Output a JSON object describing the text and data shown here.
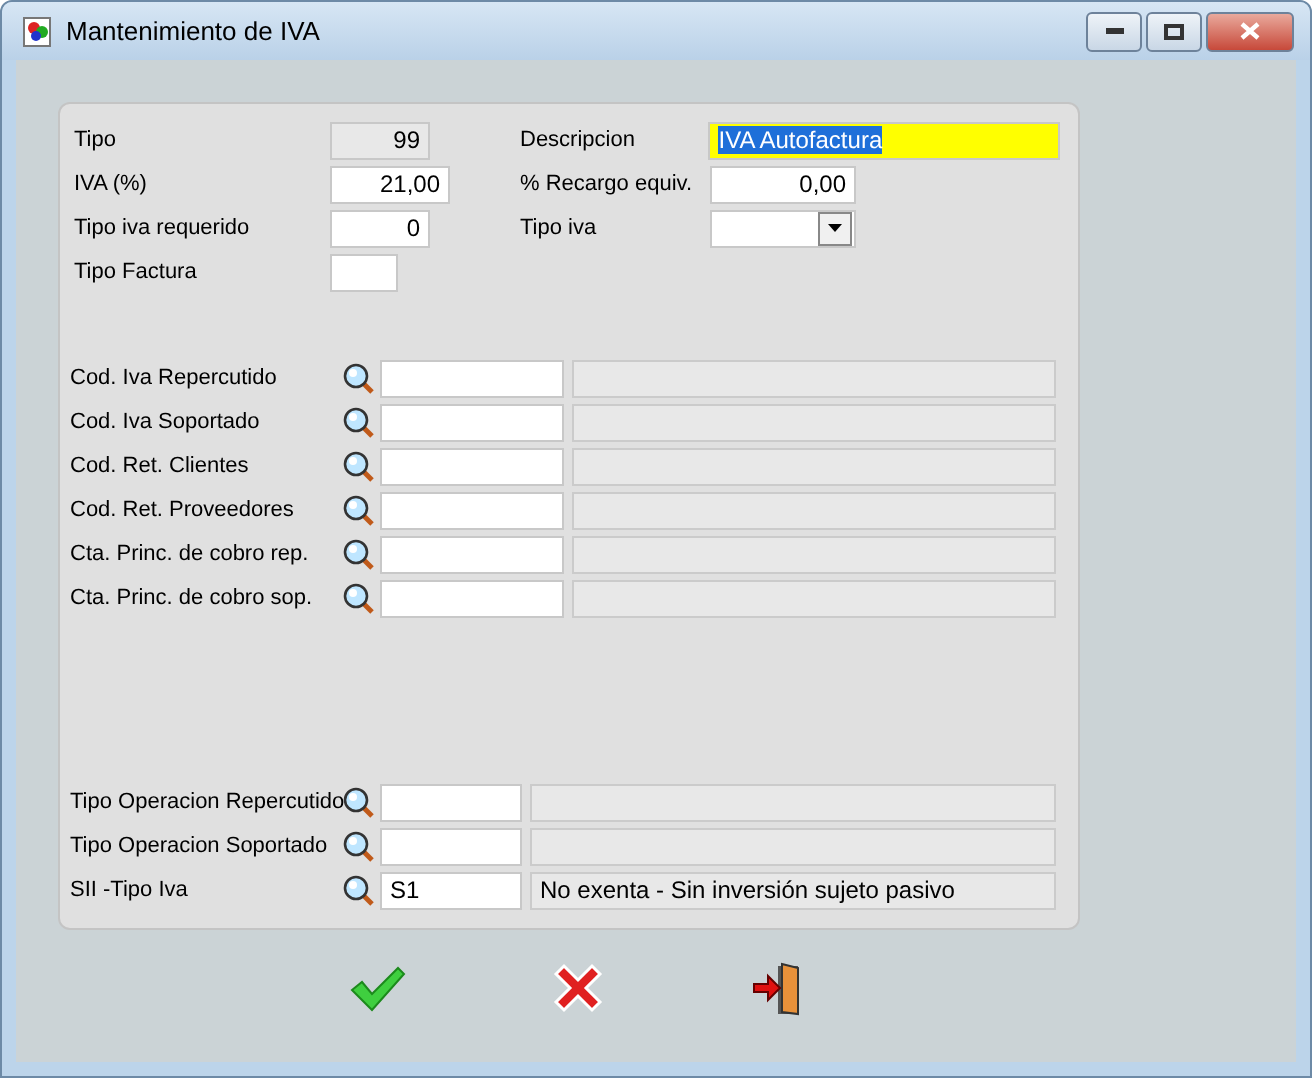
{
  "window": {
    "title": "Mantenimiento de IVA"
  },
  "top_rows": [
    {
      "left": {
        "label": "Tipo",
        "value": "99",
        "kind": "readonly"
      },
      "right": {
        "label": "Descripcion",
        "value": "IVA Autofactura",
        "kind": "highlight",
        "selected": true
      }
    },
    {
      "left": {
        "label": "IVA (%)",
        "value": "21,00",
        "kind": "text"
      },
      "right": {
        "label": "% Recargo equiv.",
        "value": "0,00",
        "kind": "text"
      }
    },
    {
      "left": {
        "label": "Tipo iva requerido",
        "value": "0",
        "kind": "text"
      },
      "right": {
        "label": "Tipo iva",
        "kind": "combo"
      }
    },
    {
      "left": {
        "label": "Tipo Factura",
        "kind": "text"
      }
    }
  ],
  "lookups": [
    {
      "label": "Cod. Iva Repercutido"
    },
    {
      "label": "Cod. Iva Soportado"
    },
    {
      "label": "Cod. Ret. Clientes"
    },
    {
      "label": "Cod. Ret. Proveedores"
    },
    {
      "label": "Cta. Princ. de cobro  rep."
    },
    {
      "label": "Cta. Princ. de cobro  sop."
    }
  ],
  "operations": [
    {
      "label": "Tipo Operacion Repercutido"
    },
    {
      "label": "Tipo Operacion Soportado"
    },
    {
      "label": "SII -Tipo Iva",
      "code": "S1",
      "description": "No exenta - Sin inversión sujeto pasivo"
    }
  ],
  "actions": [
    {
      "kind": "accept"
    },
    {
      "kind": "cancel"
    },
    {
      "kind": "exit"
    }
  ]
}
